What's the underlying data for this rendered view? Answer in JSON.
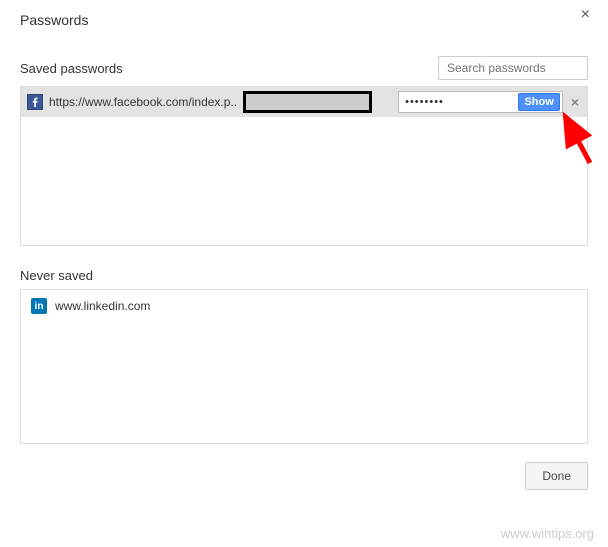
{
  "dialog": {
    "title": "Passwords"
  },
  "saved": {
    "label": "Saved passwords",
    "search_placeholder": "Search passwords",
    "entries": [
      {
        "site": "https://www.facebook.com/index.p..",
        "password_mask": "••••••••",
        "show_label": "Show"
      }
    ]
  },
  "never": {
    "label": "Never saved",
    "entries": [
      {
        "site": "www.linkedin.com"
      }
    ]
  },
  "footer": {
    "done_label": "Done"
  },
  "watermark": "www.wintips.org"
}
